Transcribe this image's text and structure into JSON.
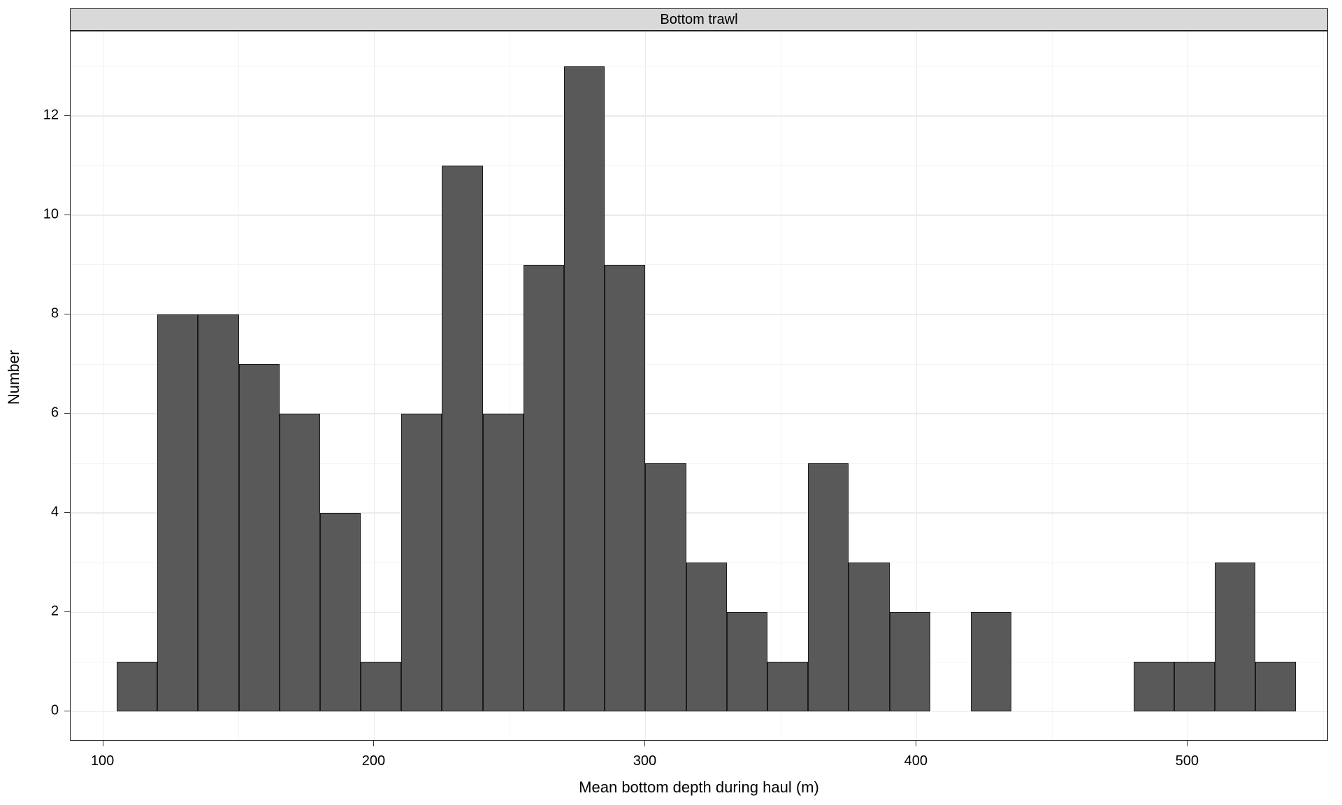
{
  "chart_data": {
    "type": "bar",
    "facet_label": "Bottom trawl",
    "xlabel": "Mean bottom depth during haul (m)",
    "ylabel": "Number",
    "xlim": [
      88,
      552
    ],
    "ylim": [
      -0.6,
      13.7
    ],
    "x_ticks": [
      100,
      200,
      300,
      400,
      500
    ],
    "y_ticks": [
      0,
      2,
      4,
      6,
      8,
      10,
      12
    ],
    "x_minor": [
      150,
      250,
      350,
      450,
      550
    ],
    "y_minor": [
      1,
      3,
      5,
      7,
      9,
      11,
      13
    ],
    "bin_width": 15,
    "bins": [
      {
        "low": 105,
        "high": 120,
        "count": 1
      },
      {
        "low": 120,
        "high": 135,
        "count": 8
      },
      {
        "low": 135,
        "high": 150,
        "count": 8
      },
      {
        "low": 150,
        "high": 165,
        "count": 7
      },
      {
        "low": 165,
        "high": 180,
        "count": 6
      },
      {
        "low": 180,
        "high": 195,
        "count": 4
      },
      {
        "low": 195,
        "high": 210,
        "count": 1
      },
      {
        "low": 210,
        "high": 225,
        "count": 6
      },
      {
        "low": 225,
        "high": 240,
        "count": 11
      },
      {
        "low": 240,
        "high": 255,
        "count": 6
      },
      {
        "low": 255,
        "high": 270,
        "count": 9
      },
      {
        "low": 270,
        "high": 285,
        "count": 13
      },
      {
        "low": 285,
        "high": 300,
        "count": 9
      },
      {
        "low": 300,
        "high": 315,
        "count": 5
      },
      {
        "low": 315,
        "high": 330,
        "count": 3
      },
      {
        "low": 330,
        "high": 345,
        "count": 2
      },
      {
        "low": 345,
        "high": 360,
        "count": 1
      },
      {
        "low": 360,
        "high": 375,
        "count": 5
      },
      {
        "low": 375,
        "high": 390,
        "count": 3
      },
      {
        "low": 390,
        "high": 405,
        "count": 2
      },
      {
        "low": 420,
        "high": 435,
        "count": 2
      },
      {
        "low": 480,
        "high": 495,
        "count": 1
      },
      {
        "low": 495,
        "high": 510,
        "count": 1
      },
      {
        "low": 510,
        "high": 525,
        "count": 3
      },
      {
        "low": 525,
        "high": 540,
        "count": 1
      }
    ],
    "bar_fill": "#595959",
    "bar_stroke": "#1a1a1a"
  }
}
